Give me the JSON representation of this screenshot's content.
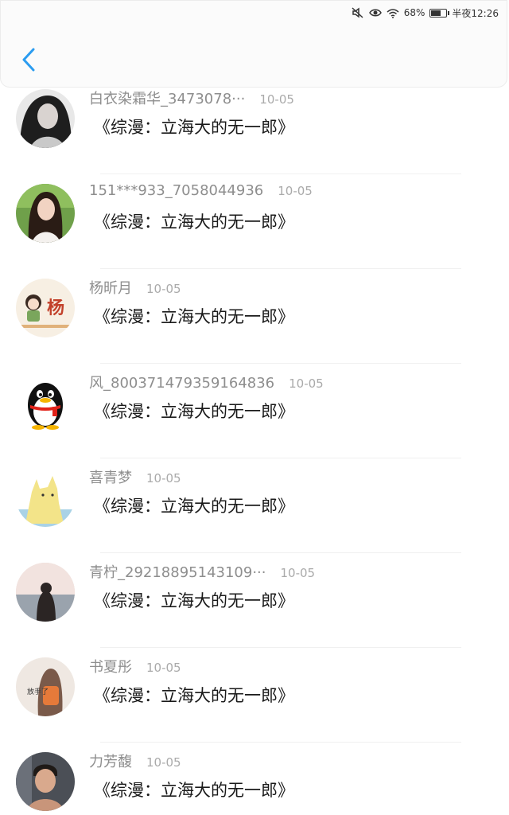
{
  "status_bar": {
    "battery_level": "68%",
    "time": "半夜12:26",
    "icons": [
      "mute-icon",
      "eye-icon",
      "wifi-icon",
      "battery-icon"
    ]
  },
  "header": {
    "back_icon": "chevron-left-icon"
  },
  "colors": {
    "accent": "#2b9cf0",
    "nickname": "#8e8e8e",
    "date": "#aaaaaa",
    "comment": "#1a1a1a"
  },
  "comments": [
    {
      "nickname": "白衣染霜华_3473078···",
      "date": "10-05",
      "text": "《综漫：立海大的无一郎》",
      "avatar": "girl-dark-hair-avatar"
    },
    {
      "nickname": "151***933_7058044936",
      "date": "10-05",
      "text": "《综漫：立海大的无一郎》",
      "avatar": "girl-photo-avatar"
    },
    {
      "nickname": "杨昕月",
      "date": "10-05",
      "text": "《综漫：立海大的无一郎》",
      "avatar": "cartoon-yang-avatar"
    },
    {
      "nickname": "风_800371479359164836",
      "date": "10-05",
      "text": "《综漫：立海大的无一郎》",
      "avatar": "penguin-avatar"
    },
    {
      "nickname": "喜青梦",
      "date": "10-05",
      "text": "《综漫：立海大的无一郎》",
      "avatar": "alpaca-avatar"
    },
    {
      "nickname": "青柠_29218895143109···",
      "date": "10-05",
      "text": "《综漫：立海大的无一郎》",
      "avatar": "seaside-girl-avatar"
    },
    {
      "nickname": "书夏彤",
      "date": "10-05",
      "text": "《综漫：立海大的无一郎》",
      "avatar": "backpack-girl-avatar"
    },
    {
      "nickname": "力芳馥",
      "date": "10-05",
      "text": "《综漫：立海大的无一郎》",
      "avatar": "man-photo-avatar"
    }
  ]
}
